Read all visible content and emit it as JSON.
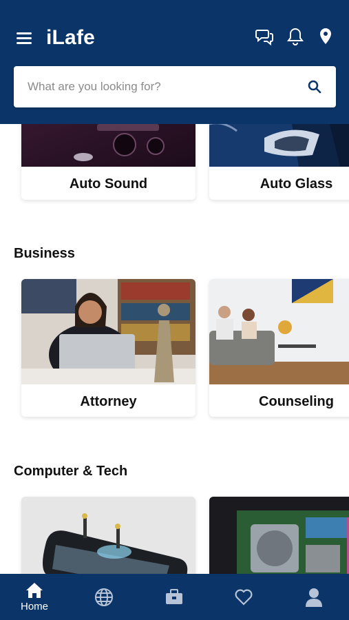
{
  "header": {
    "title": "iLafe",
    "menu_icon": "hamburger-menu-icon",
    "icons": [
      "chat-bubbles-icon",
      "bell-icon",
      "location-pin-icon"
    ],
    "background_color": "#0b3568"
  },
  "search": {
    "placeholder": "What are you looking for?",
    "value": ""
  },
  "sections": [
    {
      "title": "",
      "cards": [
        {
          "label": "Auto Sound",
          "image": "car-audio-photo"
        },
        {
          "label": "Auto Glass",
          "image": "car-headlight-photo"
        }
      ]
    },
    {
      "title": "Business",
      "cards": [
        {
          "label": "Attorney",
          "image": "attorney-office-photo"
        },
        {
          "label": "Counseling",
          "image": "counseling-room-photo"
        }
      ]
    },
    {
      "title": "Computer & Tech",
      "cards": [
        {
          "label": "",
          "image": "phone-repair-photo"
        },
        {
          "label": "",
          "image": "motherboard-photo"
        }
      ]
    }
  ],
  "bottom_nav": {
    "items": [
      {
        "label": "Home",
        "icon": "home-icon",
        "active": true
      },
      {
        "label": "",
        "icon": "globe-icon",
        "active": false
      },
      {
        "label": "",
        "icon": "briefcase-icon",
        "active": false
      },
      {
        "label": "",
        "icon": "heart-icon",
        "active": false
      },
      {
        "label": "",
        "icon": "profile-icon",
        "active": false
      }
    ]
  }
}
